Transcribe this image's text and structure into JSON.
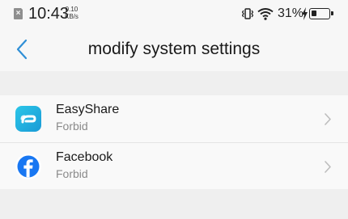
{
  "status_bar": {
    "time": "10:43",
    "net_speed_value": "0.10",
    "net_speed_unit": "KB/s",
    "battery_percent": "31%",
    "battery_level": 0.31
  },
  "header": {
    "title": "modify system settings"
  },
  "apps": [
    {
      "name": "EasyShare",
      "status": "Forbid",
      "icon": "easyshare-icon"
    },
    {
      "name": "Facebook",
      "status": "Forbid",
      "icon": "facebook-icon"
    }
  ],
  "colors": {
    "accent": "#2f8fd6",
    "background": "#efefef",
    "list_background": "#f9f9f9",
    "secondary_text": "#8a8a8a",
    "facebook_blue": "#1877f2",
    "easyshare_cyan": "#1fb6de"
  }
}
